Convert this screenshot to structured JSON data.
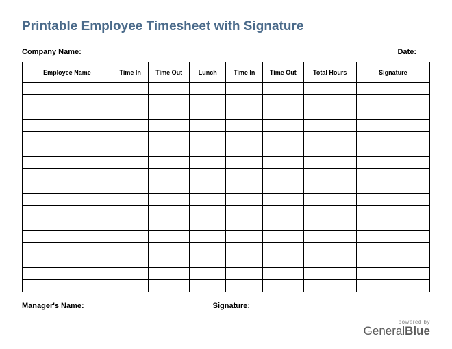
{
  "title": "Printable Employee Timesheet with Signature",
  "header": {
    "company_label": "Company Name:",
    "date_label": "Date:"
  },
  "columns": [
    "Employee Name",
    "Time In",
    "Time Out",
    "Lunch",
    "Time In",
    "Time Out",
    "Total Hours",
    "Signature"
  ],
  "row_count": 17,
  "footer": {
    "manager_label": "Manager's Name:",
    "signature_label": "Signature:"
  },
  "brand": {
    "powered_by": "powered by",
    "name_light": "General",
    "name_bold": "Blue"
  }
}
